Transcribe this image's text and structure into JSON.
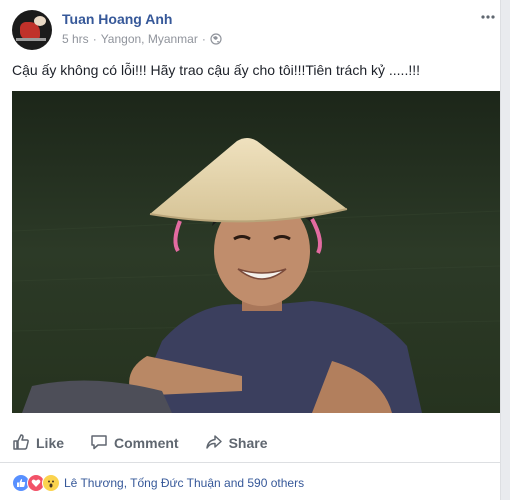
{
  "post": {
    "author": "Tuan Hoang Anh",
    "time": "5 hrs",
    "separator1": "·",
    "location": "Yangon, Myanmar",
    "separator2": "·",
    "privacy_icon": "globe-icon",
    "text": "Cậu ấy không có lỗi!!! Hãy trao cậu ấy cho tôi!!!Tiên trách kỷ .....!!!"
  },
  "actions": {
    "like": "Like",
    "comment": "Comment",
    "share": "Share"
  },
  "reactions": {
    "icons": [
      "like-icon",
      "love-icon",
      "wow-icon"
    ],
    "summary": "Lê Thương, Tống Đức Thuận and 590 others"
  },
  "colors": {
    "link": "#365899",
    "text": "#1d2129",
    "muted": "#90949c",
    "action": "#606770",
    "like": "#5890ff",
    "love": "#f25268",
    "wow": "#fbd34e"
  }
}
